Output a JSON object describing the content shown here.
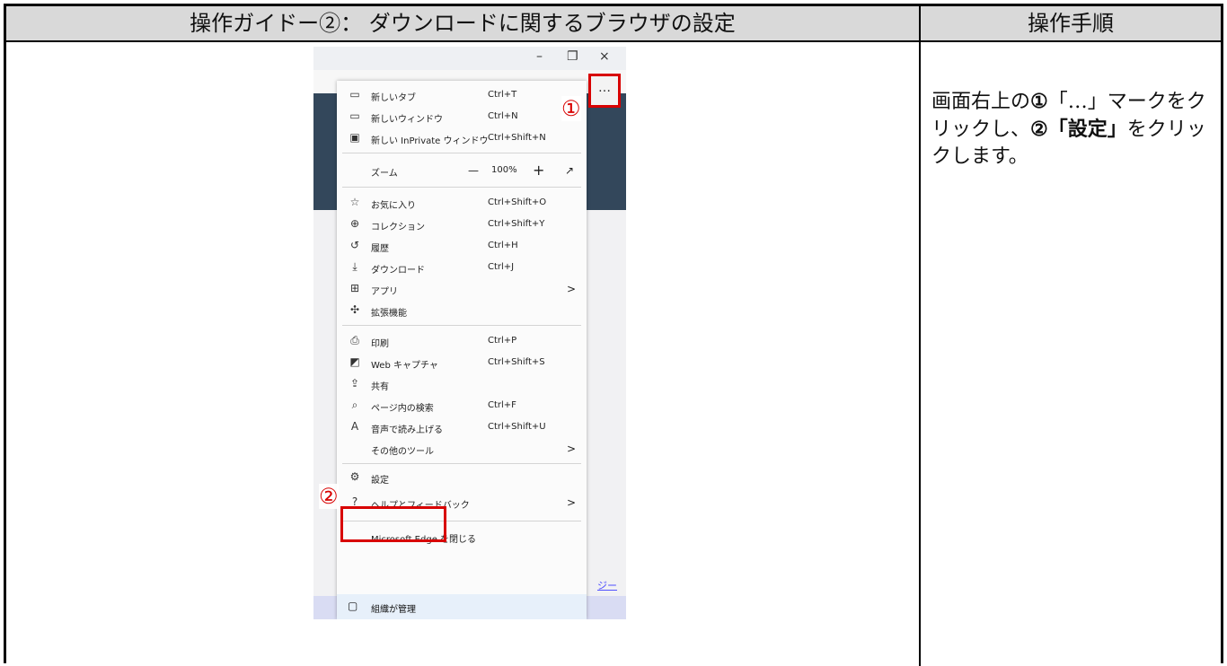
{
  "header": {
    "title": "操作ガイドー②： ダウンロードに関するブラウザの設定",
    "steps_label": "操作手順"
  },
  "instructions": {
    "p1": "画面右上の",
    "n1": "①",
    "p2": "「…」マークをクリックし、",
    "n2": "②",
    "p3": "「設定」",
    "p4": "をクリックします。"
  },
  "browser": {
    "window_controls": [
      "–",
      "❐",
      "×"
    ],
    "more_button": "…",
    "callout_1": "①",
    "callout_2": "②",
    "privacy_link": "ジー"
  },
  "menu": {
    "new_tab": {
      "label": "新しいタブ",
      "shortcut": "Ctrl+T",
      "icon": "tab-icon"
    },
    "new_window": {
      "label": "新しいウィンドウ",
      "shortcut": "Ctrl+N",
      "icon": "window-icon"
    },
    "inprivate": {
      "label": "新しい InPrivate ウィンドウ",
      "shortcut": "Ctrl+Shift+N",
      "icon": "inprivate-icon"
    },
    "zoom": {
      "label": "ズーム",
      "minus": "—",
      "value": "100%",
      "plus": "+",
      "expand": "↗"
    },
    "favorites": {
      "label": "お気に入り",
      "shortcut": "Ctrl+Shift+O",
      "icon": "favorites-icon"
    },
    "collections": {
      "label": "コレクション",
      "shortcut": "Ctrl+Shift+Y",
      "icon": "collections-icon"
    },
    "history": {
      "label": "履歴",
      "shortcut": "Ctrl+H",
      "icon": "history-icon"
    },
    "downloads": {
      "label": "ダウンロード",
      "shortcut": "Ctrl+J",
      "icon": "download-icon"
    },
    "apps": {
      "label": "アプリ",
      "arrow": ">",
      "icon": "apps-icon"
    },
    "extensions": {
      "label": "拡張機能",
      "icon": "extensions-icon"
    },
    "print": {
      "label": "印刷",
      "shortcut": "Ctrl+P",
      "icon": "print-icon"
    },
    "web_capture": {
      "label": "Web キャプチャ",
      "shortcut": "Ctrl+Shift+S",
      "icon": "capture-icon"
    },
    "share": {
      "label": "共有",
      "icon": "share-icon"
    },
    "find": {
      "label": "ページ内の検索",
      "shortcut": "Ctrl+F",
      "icon": "find-icon"
    },
    "read_aloud": {
      "label": "音声で読み上げる",
      "shortcut": "Ctrl+Shift+U",
      "icon": "read-aloud-icon"
    },
    "more_tools": {
      "label": "その他のツール",
      "arrow": ">"
    },
    "settings": {
      "label": "設定",
      "icon": "settings-icon"
    },
    "help": {
      "label": "ヘルプとフィードバック",
      "arrow": ">",
      "icon": "help-icon"
    },
    "close_edge": {
      "label": "Microsoft Edge を閉じる"
    },
    "managed": {
      "label": "組織が管理",
      "icon": "briefcase-icon"
    }
  }
}
